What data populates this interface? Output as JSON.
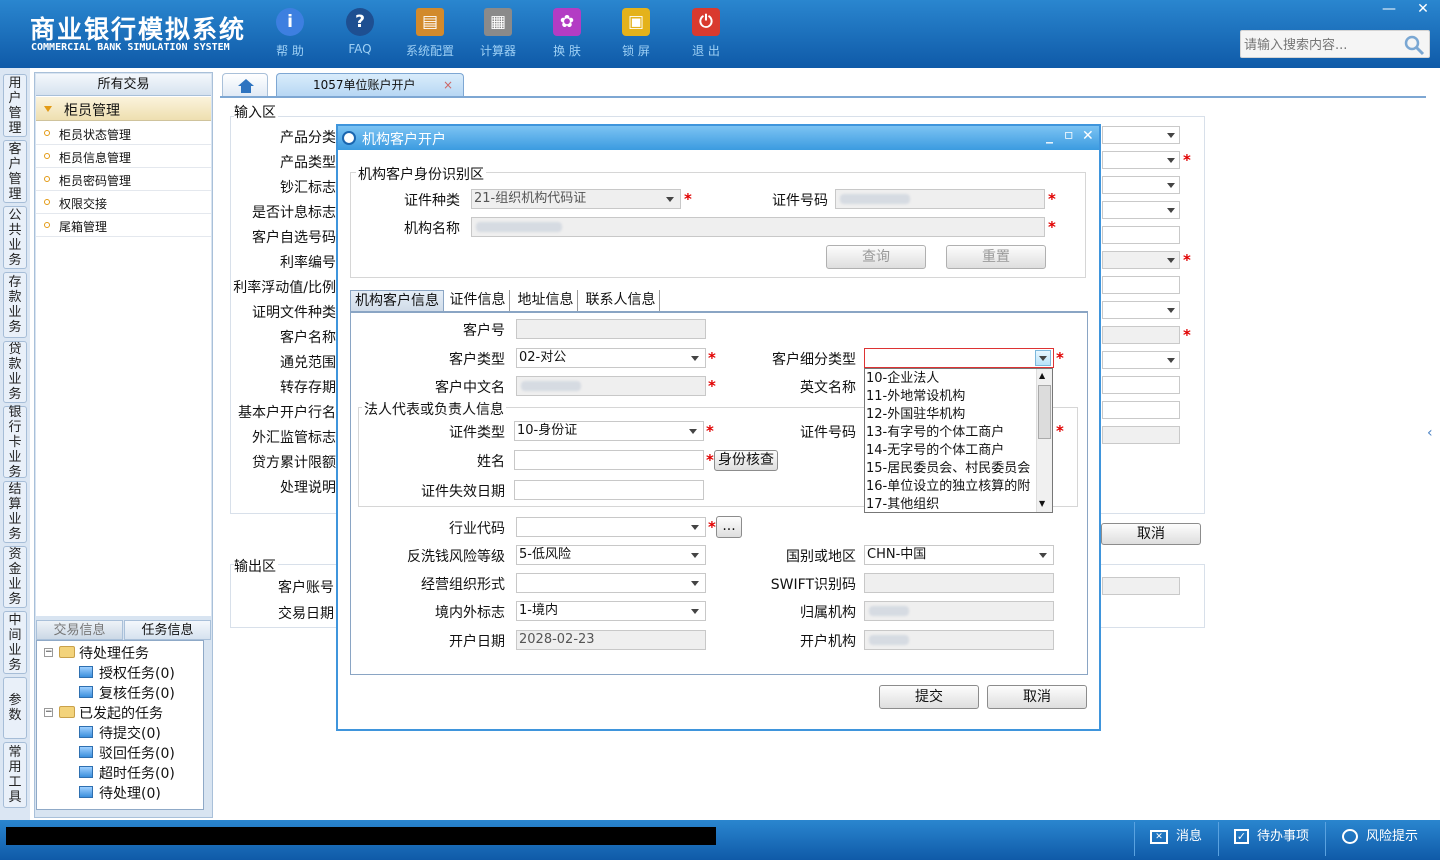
{
  "header": {
    "brand_cn": "商业银行模拟系统",
    "brand_en": "COMMERCIAL BANK SIMULATION SYSTEM",
    "toolbar": [
      {
        "label": "帮 助",
        "icon": "info-icon",
        "glyph": "i",
        "color": "#3d7fe0"
      },
      {
        "label": "FAQ",
        "icon": "help-icon",
        "glyph": "?",
        "color": "#1e4f91"
      },
      {
        "label": "系统配置",
        "icon": "toolbox-icon",
        "glyph": "▤",
        "color": "#d28a2c"
      },
      {
        "label": "计算器",
        "icon": "calculator-icon",
        "glyph": "▦",
        "color": "#8a8a8a"
      },
      {
        "label": "换 肤",
        "icon": "tshirt-icon",
        "glyph": "✿",
        "color": "#b33cc4"
      },
      {
        "label": "锁 屏",
        "icon": "lock-icon",
        "glyph": "▣",
        "color": "#e4b21b"
      },
      {
        "label": "退 出",
        "icon": "power-icon",
        "glyph": "⏻",
        "color": "#d93a2f"
      }
    ],
    "search_placeholder": "请输入搜索内容...",
    "win_min": "—",
    "win_close": "✕"
  },
  "vtabs": [
    "用户管理",
    "客户管理",
    "公共业务",
    "存款业务",
    "贷款业务",
    "银行卡业务",
    "结算业务",
    "资金业务",
    "中间业务",
    "参数",
    "常用工具"
  ],
  "left_panel": {
    "title": "所有交易",
    "group": "柜员管理",
    "items": [
      "柜员状态管理",
      "柜员信息管理",
      "柜员密码管理",
      "权限交接",
      "尾箱管理"
    ],
    "tabs": [
      "交易信息",
      "任务信息"
    ],
    "tree": {
      "pending": "待处理任务",
      "pending_children": [
        "授权任务(0)",
        "复核任务(0)"
      ],
      "initiated": "已发起的任务",
      "initiated_children": [
        "待提交(0)",
        "驳回任务(0)",
        "超时任务(0)",
        "待处理(0)"
      ]
    }
  },
  "main_tabs": {
    "active": "1057单位账户开户",
    "close": "×"
  },
  "bg_form": {
    "input_area": "输入区",
    "labels": [
      "产品分类",
      "产品类型",
      "钞汇标志",
      "是否计息标志",
      "客户自选号码",
      "利率编号",
      "利率浮动值/比例",
      "证明文件种类",
      "客户名称",
      "通兑范围",
      "转存存期",
      "基本户开户行名",
      "外汇监管标志",
      "贷方累计限额",
      "处理说明"
    ],
    "output_area": "输出区",
    "output_labels": [
      "客户账号",
      "交易日期"
    ],
    "cancel": "取消"
  },
  "dialog": {
    "title": "机构客户开户",
    "id_section": "机构客户身份识别区",
    "cert_type_label": "证件种类",
    "cert_type_value": "21-组织机构代码证",
    "cert_no_label": "证件号码",
    "org_name_label": "机构名称",
    "query": "查询",
    "reset": "重置",
    "tabs": [
      "机构客户信息",
      "证件信息",
      "地址信息",
      "联系人信息"
    ],
    "fields": {
      "customer_no": "客户号",
      "customer_type": "客户类型",
      "customer_type_value": "02-对公",
      "customer_subtype": "客户细分类型",
      "cn_name": "客户中文名",
      "en_name": "英文名称",
      "legal_section": "法人代表或负责人信息",
      "id_type": "证件类型",
      "id_type_value": "10-身份证",
      "id_no": "证件号码",
      "name": "姓名",
      "verify": "身份核查",
      "expiry": "证件失效日期",
      "industry": "行业代码",
      "more": "...",
      "aml_level": "反洗钱风险等级",
      "aml_level_value": "5-低风险",
      "country": "国别或地区",
      "country_value": "CHN-中国",
      "org_form": "经营组织形式",
      "swift": "SWIFT识别码",
      "domestic": "境内外标志",
      "domestic_value": "1-境内",
      "belong_org": "归属机构",
      "open_date": "开户日期",
      "open_date_value": "2028-02-23",
      "open_org": "开户机构"
    },
    "dropdown_options": [
      "10-企业法人",
      "11-外地常设机构",
      "12-外国驻华机构",
      "13-有字号的个体工商户",
      "14-无字号的个体工商户",
      "15-居民委员会、村民委员会",
      "16-单位设立的独立核算的附",
      "17-其他组织"
    ],
    "submit": "提交",
    "cancel": "取消"
  },
  "status": {
    "message": "消息",
    "todo": "待办事项",
    "risk": "风险提示"
  },
  "colors": {
    "header": "#1a6fbf",
    "dialog_border": "#3f95dc",
    "required": "#e10000"
  }
}
